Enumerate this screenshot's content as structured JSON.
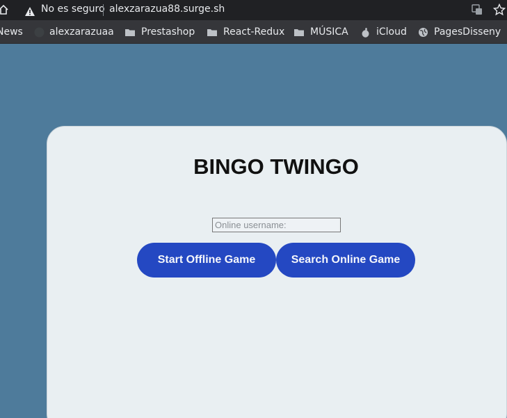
{
  "browser": {
    "security_label": "No es seguro",
    "url": "alexzarazua88.surge.sh"
  },
  "bookmarks": [
    {
      "label": "News",
      "icon": "news-icon"
    },
    {
      "label": "alexzarazuaa",
      "icon": "github-icon"
    },
    {
      "label": "Prestashop",
      "icon": "folder-icon"
    },
    {
      "label": "React-Redux",
      "icon": "folder-icon"
    },
    {
      "label": "MÚSICA",
      "icon": "folder-icon"
    },
    {
      "label": "iCloud",
      "icon": "apple-icon"
    },
    {
      "label": "PagesDisseny",
      "icon": "globe-icon"
    }
  ],
  "page": {
    "title": "BINGO TWINGO",
    "username_placeholder": "Online username:",
    "start_offline_label": "Start Offline Game",
    "search_online_label": "Search Online Game"
  },
  "colors": {
    "background": "#4e7b9b",
    "card": "#e9eff2",
    "button": "#2448c2"
  }
}
